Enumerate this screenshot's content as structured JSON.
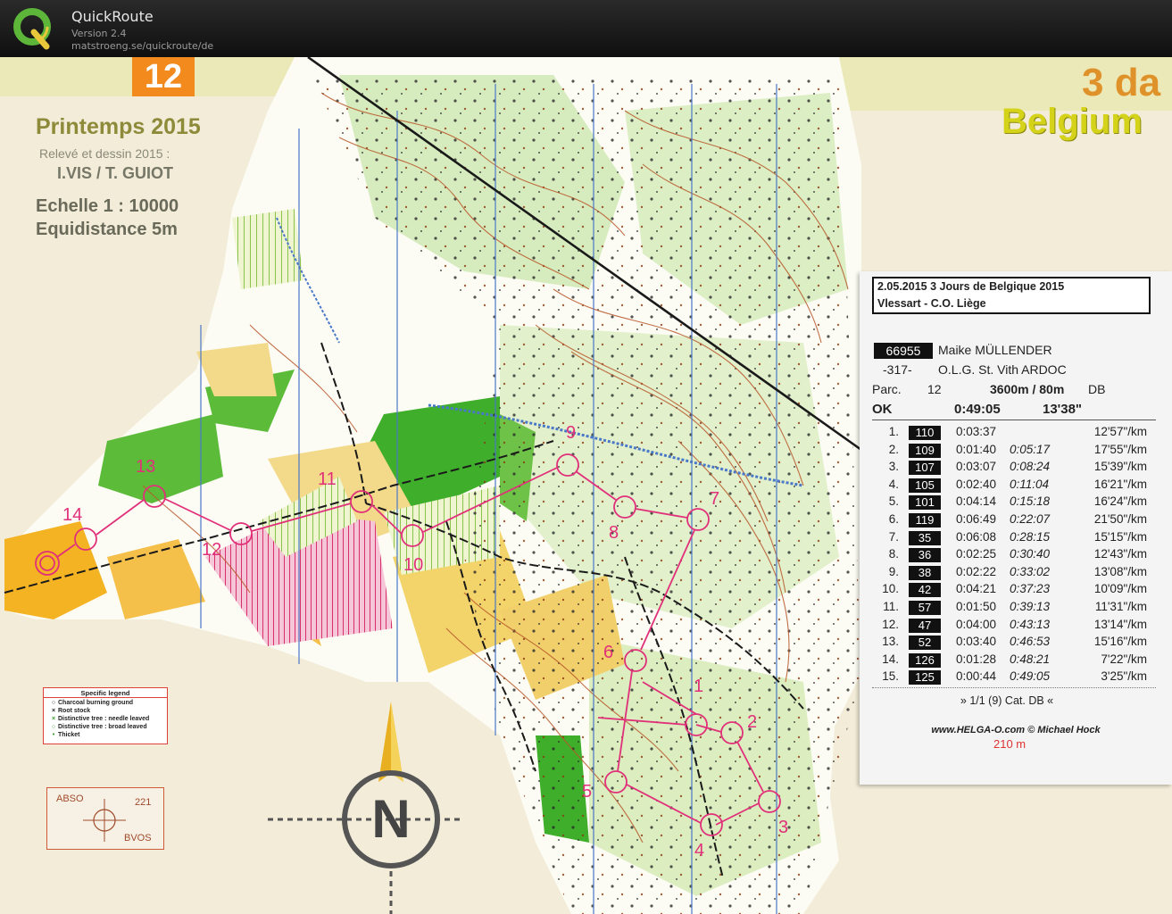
{
  "app": {
    "title": "QuickRoute",
    "version": "Version 2.4",
    "url": "matstroeng.se/quickroute/de",
    "logo_icon": "quickroute-q-logo-icon"
  },
  "map_info": {
    "course_badge": "12",
    "title": "Printemps 2015",
    "survey_line": "Relevé et dessin 2015 :",
    "authors": "I.VIS / T. GUIOT",
    "scale": "Echelle  1 : 10000",
    "contour": "Equidistance  5m",
    "event_banner": "Belgium",
    "event_banner_prefix": "3 da"
  },
  "ticket": {
    "date_event": "2.05.2015   3 Jours de Belgique 2015",
    "place": "Vlessart - C.O. Liège",
    "runner_number": "66955",
    "runner_name": "Maike MÜLLENDER",
    "start_code": "-317-",
    "club": "O.L.G. St. Vith ARDOC",
    "parc_label": "Parc.",
    "parc_value": "12",
    "length": "3600m / 80m",
    "category": "DB",
    "status": "OK",
    "total_time": "0:49:05",
    "total_pace": "13'38\"",
    "splits": [
      {
        "idx": "1.",
        "code": "110",
        "leg": "0:03:37",
        "cum": "",
        "pace": "12'57\"/km"
      },
      {
        "idx": "2.",
        "code": "109",
        "leg": "0:01:40",
        "cum": "0:05:17",
        "pace": "17'55\"/km"
      },
      {
        "idx": "3.",
        "code": "107",
        "leg": "0:03:07",
        "cum": "0:08:24",
        "pace": "15'39\"/km"
      },
      {
        "idx": "4.",
        "code": "105",
        "leg": "0:02:40",
        "cum": "0:11:04",
        "pace": "16'21\"/km"
      },
      {
        "idx": "5.",
        "code": "101",
        "leg": "0:04:14",
        "cum": "0:15:18",
        "pace": "16'24\"/km"
      },
      {
        "idx": "6.",
        "code": "119",
        "leg": "0:06:49",
        "cum": "0:22:07",
        "pace": "21'50\"/km"
      },
      {
        "idx": "7.",
        "code": "35",
        "leg": "0:06:08",
        "cum": "0:28:15",
        "pace": "15'15\"/km"
      },
      {
        "idx": "8.",
        "code": "36",
        "leg": "0:02:25",
        "cum": "0:30:40",
        "pace": "12'43\"/km"
      },
      {
        "idx": "9.",
        "code": "38",
        "leg": "0:02:22",
        "cum": "0:33:02",
        "pace": "13'08\"/km"
      },
      {
        "idx": "10.",
        "code": "42",
        "leg": "0:04:21",
        "cum": "0:37:23",
        "pace": "10'09\"/km"
      },
      {
        "idx": "11.",
        "code": "57",
        "leg": "0:01:50",
        "cum": "0:39:13",
        "pace": "11'31\"/km"
      },
      {
        "idx": "12.",
        "code": "47",
        "leg": "0:04:00",
        "cum": "0:43:13",
        "pace": "13'14\"/km"
      },
      {
        "idx": "13.",
        "code": "52",
        "leg": "0:03:40",
        "cum": "0:46:53",
        "pace": "15'16\"/km"
      },
      {
        "idx": "14.",
        "code": "126",
        "leg": "0:01:28",
        "cum": "0:48:21",
        "pace": "7'22\"/km"
      },
      {
        "idx": "15.",
        "code": "125",
        "leg": "0:00:44",
        "cum": "0:49:05",
        "pace": "3'25\"/km"
      }
    ],
    "footer_category": "» 1/1 (9) Cat. DB «",
    "footer_credit": "www.HELGA-O.com © Michael Hock",
    "overlap_text": "210 m"
  },
  "legend": {
    "title": "Specific legend",
    "items": [
      {
        "symbol": "○",
        "label": "Charcoal burning ground"
      },
      {
        "symbol": "×",
        "label": "Root stock"
      },
      {
        "symbol": "×",
        "label": "Distinctive tree : needle leaved"
      },
      {
        "symbol": "○",
        "label": "Distinctive tree : broad leaved"
      },
      {
        "symbol": "•",
        "label": "Thicket"
      }
    ]
  },
  "declination": {
    "left": "ABSO",
    "right": "221",
    "bottom": "BVOS"
  },
  "north_arrow": {
    "letter": "N"
  },
  "controls": [
    "1",
    "2",
    "3",
    "4",
    "5",
    "6",
    "7",
    "8",
    "9",
    "10",
    "11",
    "12",
    "13",
    "14"
  ]
}
